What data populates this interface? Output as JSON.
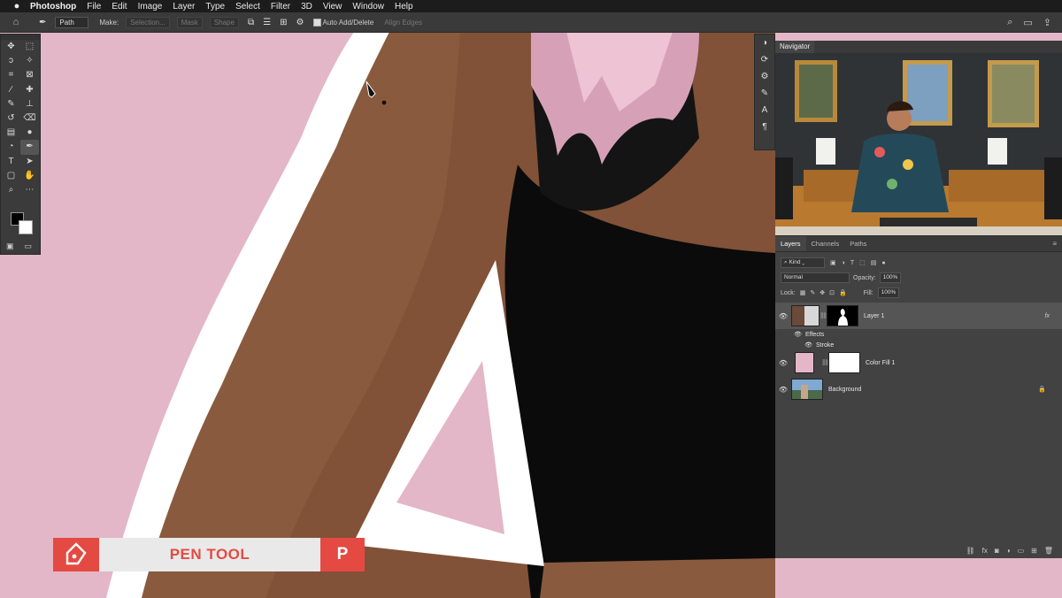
{
  "menubar": {
    "app_name": "Photoshop",
    "items": [
      "File",
      "Edit",
      "Image",
      "Layer",
      "Type",
      "Select",
      "Filter",
      "3D",
      "View",
      "Window",
      "Help"
    ]
  },
  "options_bar": {
    "mode_select": "Path",
    "make_label": "Make:",
    "selection_button": "Selection...",
    "mask_button": "Mask",
    "shape_button": "Shape",
    "auto_add_delete_label": "Auto Add/Delete",
    "align_edges_label": "Align Edges"
  },
  "navigator": {
    "tab_label": "Navigator"
  },
  "layers_panel": {
    "tabs": [
      "Layers",
      "Channels",
      "Paths"
    ],
    "filter_kind": "Kind",
    "blend_mode": "Normal",
    "opacity_label": "Opacity:",
    "opacity_value": "100%",
    "lock_label": "Lock:",
    "fill_label": "Fill:",
    "fill_value": "100%",
    "layers": [
      {
        "name": "Layer 1"
      },
      {
        "name": "Color Fill 1"
      },
      {
        "name": "Background"
      }
    ],
    "effects_label": "Effects",
    "stroke_label": "Stroke",
    "fx_badge": "fx"
  },
  "lower_third": {
    "label": "PEN TOOL",
    "shortcut_key": "P"
  },
  "colors": {
    "accent_red": "#e44a42",
    "canvas_pink": "#e3b7c7",
    "panel_gray": "#424242"
  }
}
